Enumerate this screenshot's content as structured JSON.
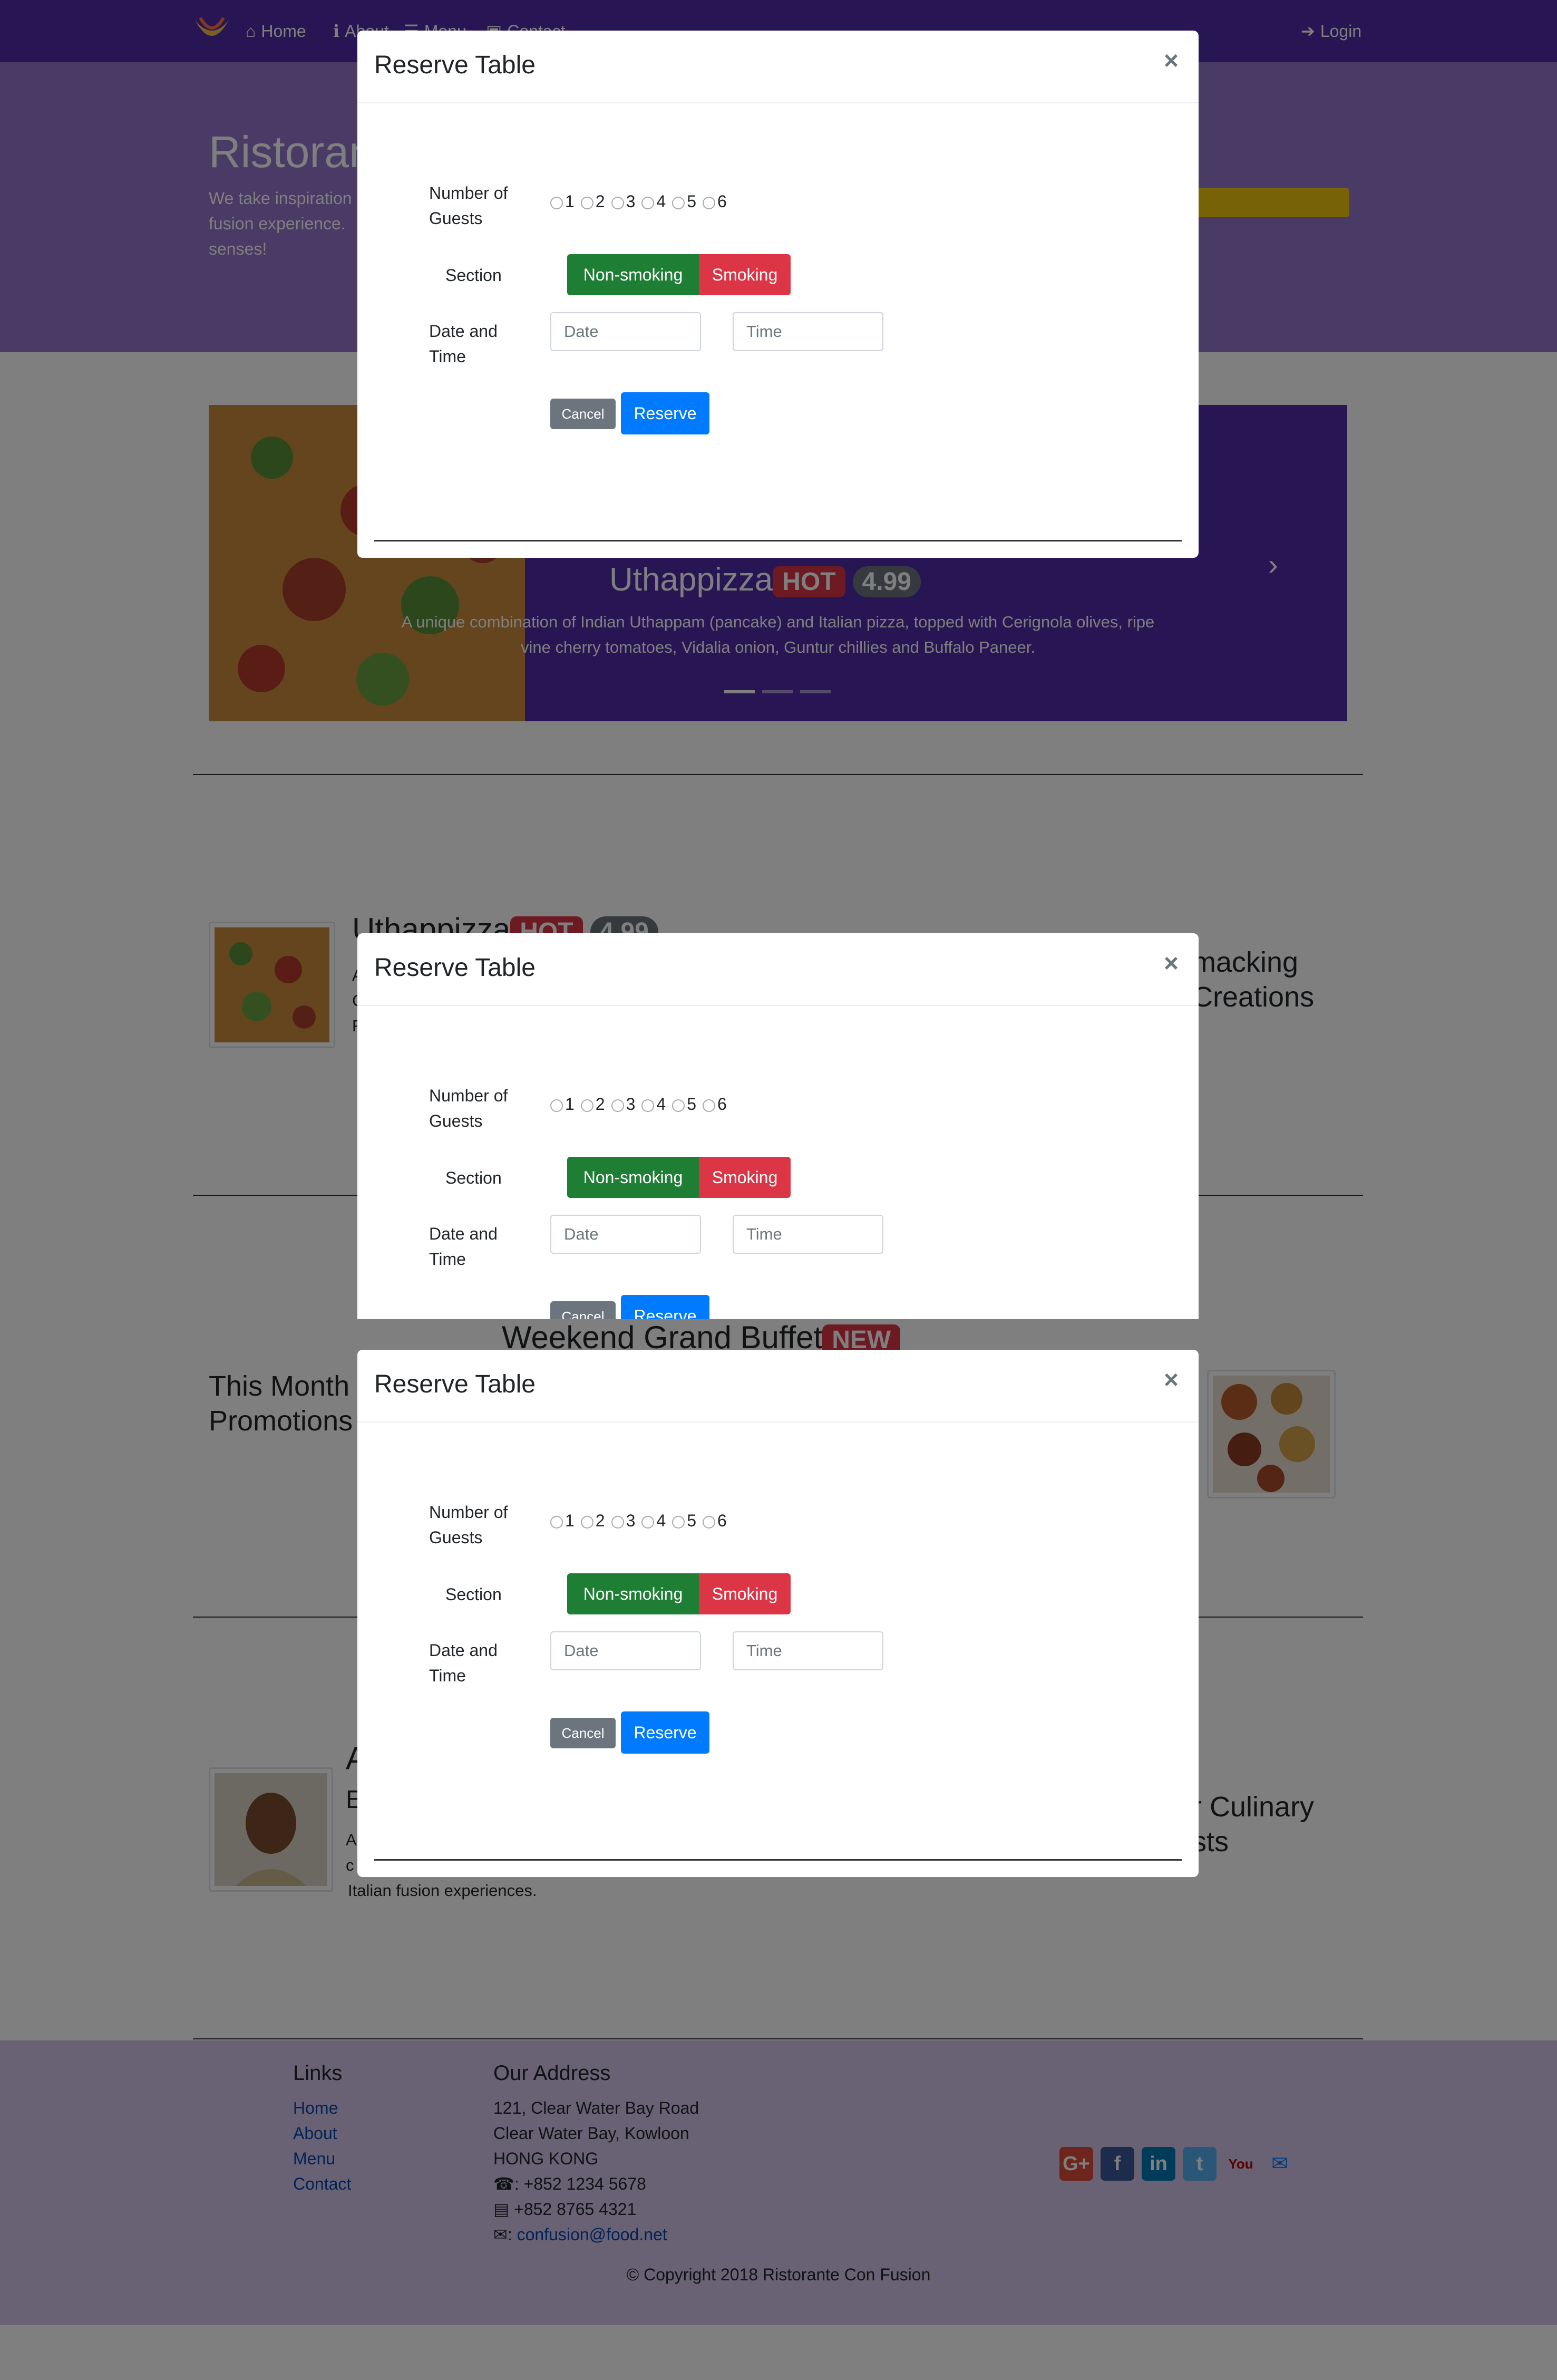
{
  "nav": {
    "items": [
      {
        "label": "Home",
        "icon": "home-icon"
      },
      {
        "label": "About",
        "icon": "info-icon"
      },
      {
        "label": "Menu",
        "icon": "list-icon"
      },
      {
        "label": "Contact",
        "icon": "address-card-icon"
      }
    ],
    "login_label": "Login"
  },
  "jumbotron": {
    "title": "Ristoran",
    "text": "We take inspiration fusion experience. senses!"
  },
  "carousel": {
    "title": "Uthappizza",
    "badge": "HOT",
    "price": "4.99",
    "description": "A unique combination of Indian Uthappam (pancake) and Italian pizza, topped with Cerignola olives, ripe vine cherry tomatoes, Vidalia onion, Guntur chillies and Buffalo Paneer."
  },
  "featured_dish": {
    "title": "Uthappizza",
    "badge": "HOT",
    "price": "4.99",
    "text_fragments": [
      "A",
      "C",
      "F"
    ],
    "side_title": "macking Creations"
  },
  "promotion": {
    "title": "Weekend Grand Buffet",
    "badge": "NEW",
    "side_title": "This Month Promotions"
  },
  "leader": {
    "initial_a": "A",
    "initial_b": "E",
    "text_fragments": [
      "A",
      "c"
    ],
    "text_tail": "Italian fusion experiences.",
    "side_title": "r Culinary sts"
  },
  "footer": {
    "links_heading": "Links",
    "links": [
      "Home",
      "About",
      "Menu",
      "Contact"
    ],
    "address_heading": "Our Address",
    "address_lines": [
      "121, Clear Water Bay Road",
      "Clear Water Bay, Kowloon",
      "HONG KONG"
    ],
    "phone": ": +852 1234 5678",
    "fax": "+852 8765 4321",
    "email_prefix": ":",
    "email": "confusion@food.net",
    "copyright": "© Copyright 2018 Ristorante Con Fusion",
    "social": [
      {
        "icon": "google-plus-icon",
        "label": "G+",
        "color": "#dd4b39"
      },
      {
        "icon": "facebook-icon",
        "label": "f",
        "color": "#3b5998"
      },
      {
        "icon": "linkedin-icon",
        "label": "in",
        "color": "#0077b5"
      },
      {
        "icon": "twitter-icon",
        "label": "t",
        "color": "#55acee"
      },
      {
        "icon": "youtube-icon",
        "label": "You",
        "color": "#bb0000"
      },
      {
        "icon": "mail-icon",
        "label": "✉",
        "color": "#007bff"
      }
    ]
  },
  "modal": {
    "title": "Reserve Table",
    "close": "×",
    "guests_label": "Number of Guests",
    "guest_options": [
      "1",
      "2",
      "3",
      "4",
      "5",
      "6"
    ],
    "section_label": "Section",
    "non_smoking": "Non-smoking",
    "smoking": "Smoking",
    "datetime_label": "Date and Time",
    "date_placeholder": "Date",
    "time_placeholder": "Time",
    "cancel": "Cancel",
    "reserve": "Reserve"
  }
}
